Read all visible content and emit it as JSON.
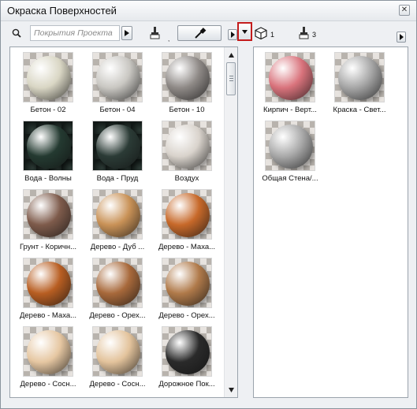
{
  "window": {
    "title": "Окраска Поверхностей",
    "close_glyph": "✕"
  },
  "toolbar": {
    "search_placeholder": "Покрытия Проекта",
    "sep_glyph": ",",
    "count_1": "1",
    "count_2": "3",
    "icons": [
      "search-icon",
      "brush-icon",
      "eyedropper-icon",
      "cube-icon",
      "brush-icon"
    ]
  },
  "left_materials": [
    {
      "label": "Бетон - 02",
      "color": "#d9d6c4"
    },
    {
      "label": "Бетон - 04",
      "color": "#c9c7c2"
    },
    {
      "label": "Бетон - 10",
      "color": "#8f8a87"
    },
    {
      "label": "Вода - Волны",
      "color": "#243a31"
    },
    {
      "label": "Вода - Пруд",
      "color": "#2b3b36"
    },
    {
      "label": "Воздух",
      "color": "#d9d3cc"
    },
    {
      "label": "Грунт - Коричн...",
      "color": "#7e5b4b"
    },
    {
      "label": "Дерево - Дуб ...",
      "color": "#c99257"
    },
    {
      "label": "Дерево - Маха...",
      "color": "#c7692a"
    },
    {
      "label": "Дерево - Маха...",
      "color": "#b85e22"
    },
    {
      "label": "Дерево - Орех...",
      "color": "#a8693b"
    },
    {
      "label": "Дерево - Орех...",
      "color": "#b07a4a"
    },
    {
      "label": "Дерево - Сосн...",
      "color": "#e6c7a2"
    },
    {
      "label": "Дерево - Сосн...",
      "color": "#e3c39c"
    },
    {
      "label": "Дорожное Пок...",
      "color": "#2a2a2a"
    }
  ],
  "right_materials": [
    {
      "label": "Кирпич - Верт...",
      "color": "#d9737c"
    },
    {
      "label": "Краска - Свет...",
      "color": "#a6a6a6"
    },
    {
      "label": "Общая Стена/...",
      "color": "#a9a9a9"
    }
  ]
}
